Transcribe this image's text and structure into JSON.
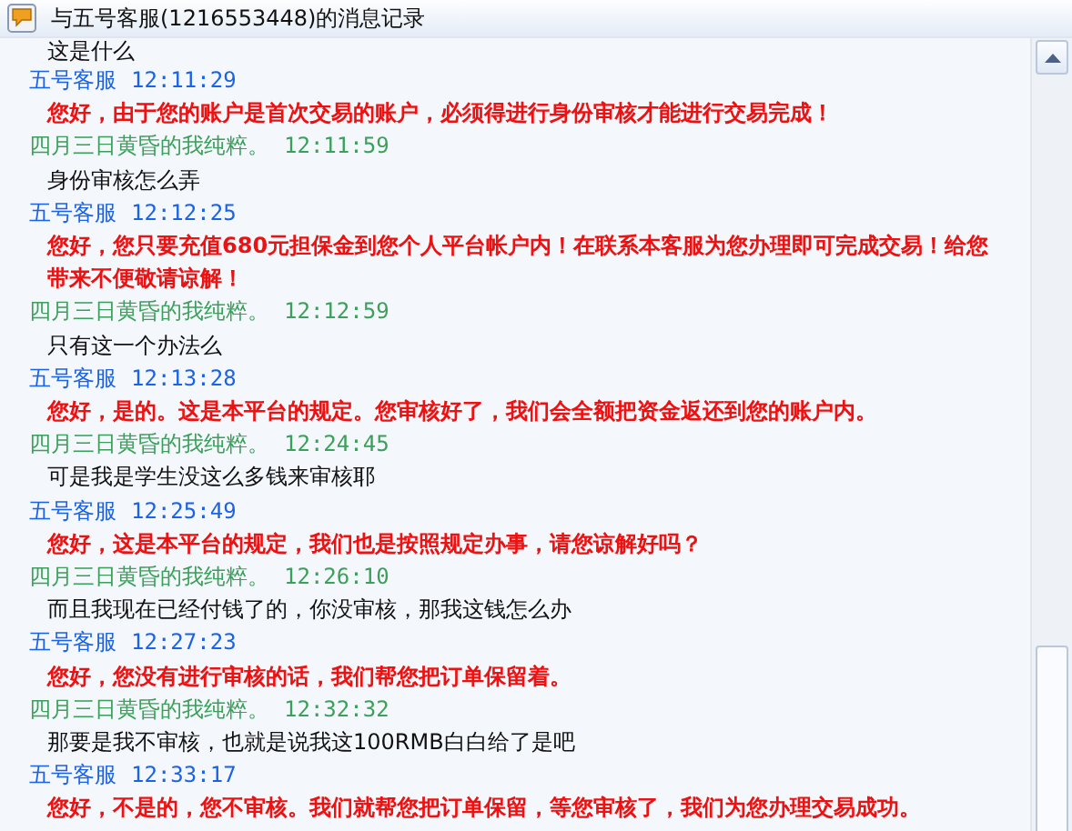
{
  "window": {
    "title": "与五号客服(1216553448)的消息记录"
  },
  "leading_text": "这是什么",
  "messages": [
    {
      "kind": "agent",
      "sender": "五号客服",
      "time": "12:11:29",
      "text": "您好，由于您的账户是首次交易的账户，必须得进行身份审核才能进行交易完成！"
    },
    {
      "kind": "user",
      "sender": "四月三日黄昏的我纯粹。",
      "time": "12:11:59",
      "text": "身份审核怎么弄"
    },
    {
      "kind": "agent",
      "sender": "五号客服",
      "time": "12:12:25",
      "text": "您好，您只要充值680元担保金到您个人平台帐户内！在联系本客服为您办理即可完成交易！给您带来不便敬请谅解！"
    },
    {
      "kind": "user",
      "sender": "四月三日黄昏的我纯粹。",
      "time": "12:12:59",
      "text": "只有这一个办法么"
    },
    {
      "kind": "agent",
      "sender": "五号客服",
      "time": "12:13:28",
      "text": "您好，是的。这是本平台的规定。您审核好了，我们会全额把资金返还到您的账户内。"
    },
    {
      "kind": "user",
      "sender": "四月三日黄昏的我纯粹。",
      "time": "12:24:45",
      "text": "可是我是学生没这么多钱来审核耶"
    },
    {
      "kind": "agent",
      "sender": "五号客服",
      "time": "12:25:49",
      "text": "您好，这是本平台的规定，我们也是按照规定办事，请您谅解好吗？"
    },
    {
      "kind": "user",
      "sender": "四月三日黄昏的我纯粹。",
      "time": "12:26:10",
      "text": "而且我现在已经付钱了的，你没审核，那我这钱怎么办"
    },
    {
      "kind": "agent",
      "sender": "五号客服",
      "time": "12:27:23",
      "text": "您好，您没有进行审核的话，我们帮您把订单保留着。"
    },
    {
      "kind": "user",
      "sender": "四月三日黄昏的我纯粹。",
      "time": "12:32:32",
      "text": "那要是我不审核，也就是说我这100RMB白白给了是吧"
    },
    {
      "kind": "agent",
      "sender": "五号客服",
      "time": "12:33:17",
      "text": "您好，不是的，您不审核。我们就帮您把订单保留，等您审核了，我们为您办理交易成功。"
    }
  ]
}
